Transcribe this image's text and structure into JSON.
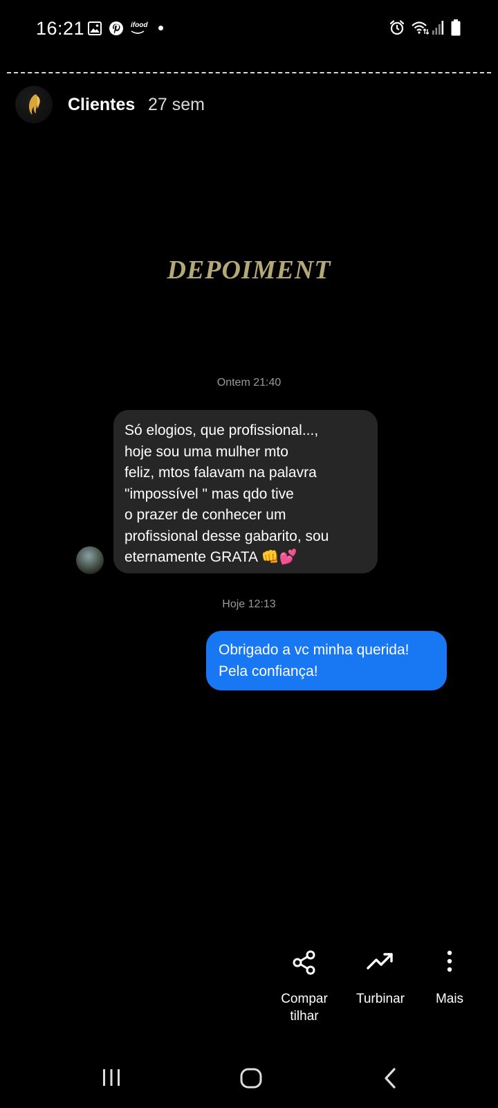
{
  "status_bar": {
    "time": "16:21",
    "ifood_label": "ifood",
    "icons_left": [
      "gallery-icon",
      "pinterest-icon",
      "ifood-icon",
      "notification-dot"
    ],
    "icons_right": [
      "alarm-icon",
      "wifi-icon",
      "signal-icon",
      "battery-icon"
    ]
  },
  "story": {
    "username": "Clientes",
    "age": "27 sem",
    "title": "DEPOIMENT",
    "title_color": "#b4a879"
  },
  "chat": {
    "timestamp_1": "Ontem 21:40",
    "received_message": "Só  elogios, que profissional...,\nhoje sou uma mulher mto\nfeliz, mtos falavam na palavra\n\"impossível \" mas qdo tive\no prazer de conhecer um\nprofissional desse gabarito, sou\neternamente GRATA 👊💕",
    "timestamp_2": "Hoje 12:13",
    "sent_message": "Obrigado a vc minha querida!\nPela confiança!",
    "received_bubble_color": "#262626",
    "sent_bubble_color": "#1877f2"
  },
  "actions": {
    "share_label": "Compar\ntilhar",
    "boost_label": "Turbinar",
    "more_label": "Mais"
  },
  "nav": {
    "buttons": [
      "recents-icon",
      "home-icon",
      "back-icon"
    ]
  }
}
